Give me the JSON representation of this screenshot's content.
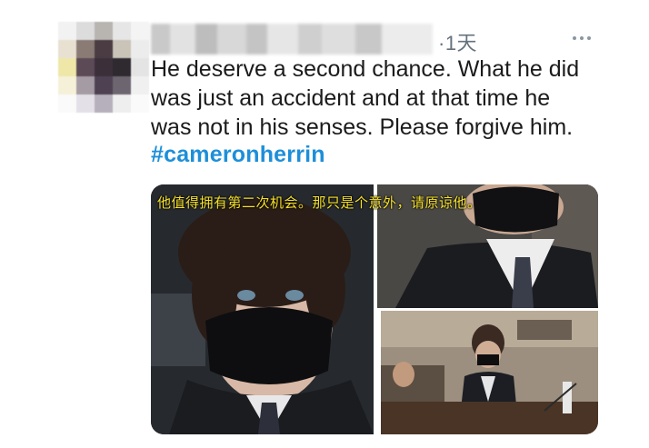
{
  "tweet": {
    "time": "·1天",
    "text": "He deserve a second chance. What he did\nwas just an accident and at that time he\nwas not in his senses. Please forgive him.",
    "hashtag": "#cameronherrin",
    "accent_color": "#1d8fd9"
  },
  "overlay": {
    "subtitle": "他值得拥有第二次机会。那只是个意外，请原谅他。",
    "subtitle_color": "#f6e12b"
  },
  "icons": {
    "more": "more-horizontal-icon"
  }
}
